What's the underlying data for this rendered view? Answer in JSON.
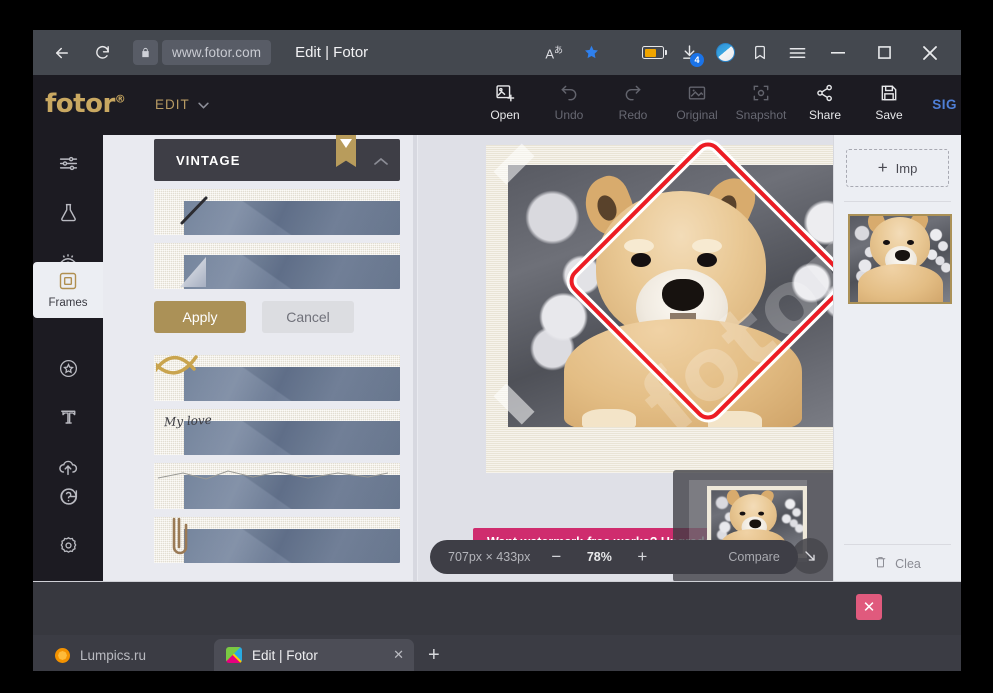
{
  "browser": {
    "url": "www.fotor.com",
    "page_title": "Edit | Fotor",
    "back_icon": "arrow-left-icon",
    "reload_icon": "reload-icon",
    "lock_icon": "lock-icon",
    "translate_label": "A",
    "translate_sup": "あ",
    "bookmark_icon": "bookmark-star-icon",
    "battery_icon": "battery-icon",
    "download_icon": "download-icon",
    "download_badge": "4",
    "weather_icon": "weather-orb-icon",
    "reading_list_icon": "reading-list-icon",
    "menu_icon": "hamburger-menu-icon",
    "minimize_label": "—",
    "maximize_label": "☐",
    "close_label": "✕"
  },
  "app": {
    "logo": "fotor",
    "logo_sup": "®",
    "edit_menu": "EDIT",
    "signin": "SIG",
    "toolbar": [
      {
        "label": "Open",
        "icon": "open-image-icon",
        "enabled": true
      },
      {
        "label": "Undo",
        "icon": "undo-icon",
        "enabled": false
      },
      {
        "label": "Redo",
        "icon": "redo-icon",
        "enabled": false
      },
      {
        "label": "Original",
        "icon": "original-image-icon",
        "enabled": false
      },
      {
        "label": "Snapshot",
        "icon": "snapshot-icon",
        "enabled": false
      },
      {
        "label": "Share",
        "icon": "share-icon",
        "enabled": true
      },
      {
        "label": "Save",
        "icon": "save-floppy-icon",
        "enabled": true
      }
    ]
  },
  "sidebar": {
    "items": [
      {
        "icon": "sliders-adjust-icon",
        "label": ""
      },
      {
        "icon": "flask-effects-icon",
        "label": ""
      },
      {
        "icon": "eye-beauty-icon",
        "label": ""
      }
    ],
    "active": {
      "icon": "frames-icon",
      "label": "Frames"
    },
    "items_after": [
      {
        "icon": "sticker-star-icon",
        "label": ""
      },
      {
        "icon": "text-tool-icon",
        "label": ""
      },
      {
        "icon": "cloud-upload-icon",
        "label": ""
      }
    ],
    "bottom": [
      {
        "icon": "help-question-icon",
        "label": ""
      },
      {
        "icon": "settings-gear-icon",
        "label": ""
      }
    ]
  },
  "panel": {
    "header_title": "VINTAGE",
    "premium_badge_icon": "premium-diamond-ribbon-icon",
    "collapse_icon": "chevron-up-icon",
    "apply_label": "Apply",
    "cancel_label": "Cancel",
    "frames_top": [
      {
        "name": "vintage-frame-brush",
        "deco": "brush-stroke"
      },
      {
        "name": "vintage-frame-triangle",
        "deco": "folded-corner"
      }
    ],
    "frames_bottom": [
      {
        "name": "vintage-frame-ribbon",
        "deco": "gold-ribbon"
      },
      {
        "name": "vintage-frame-my-love",
        "deco": "script-text",
        "text": "My love"
      },
      {
        "name": "vintage-frame-crack",
        "deco": "crack-line"
      },
      {
        "name": "vintage-frame-paperclip",
        "deco": "paperclip"
      }
    ]
  },
  "canvas": {
    "watermark_text": "fotor",
    "banner_text": "Want watermark-free works? Upgrade no",
    "dimensions": "707px × 433px",
    "zoom_out_label": "−",
    "zoom_level": "78%",
    "zoom_in_label": "+",
    "compare_label": "Compare",
    "navigator_collapse_icon": "collapse-arrow-icon"
  },
  "right_panel": {
    "import_label": "Imp",
    "import_plus": "+",
    "clear_label": "Clea",
    "clear_icon": "trash-icon",
    "thumb_name": "imported-photo-thumbnail"
  },
  "taskbar": {
    "close_overlay_label": "✕",
    "tabs": [
      {
        "title": "Lumpics.ru",
        "favicon": "orange-circle-favicon",
        "active": false
      },
      {
        "title": "Edit | Fotor",
        "favicon": "fotor-colorful-favicon",
        "active": true,
        "close": "✕"
      }
    ],
    "new_tab_label": "+"
  },
  "colors": {
    "accent_gold": "#ab9157",
    "banner_pink": "#cf2c6e",
    "watermark_red": "#ed1c24",
    "chrome_bg": "#44484f",
    "app_dark": "#1c1b22",
    "panel_bg": "#e9eaf0"
  }
}
